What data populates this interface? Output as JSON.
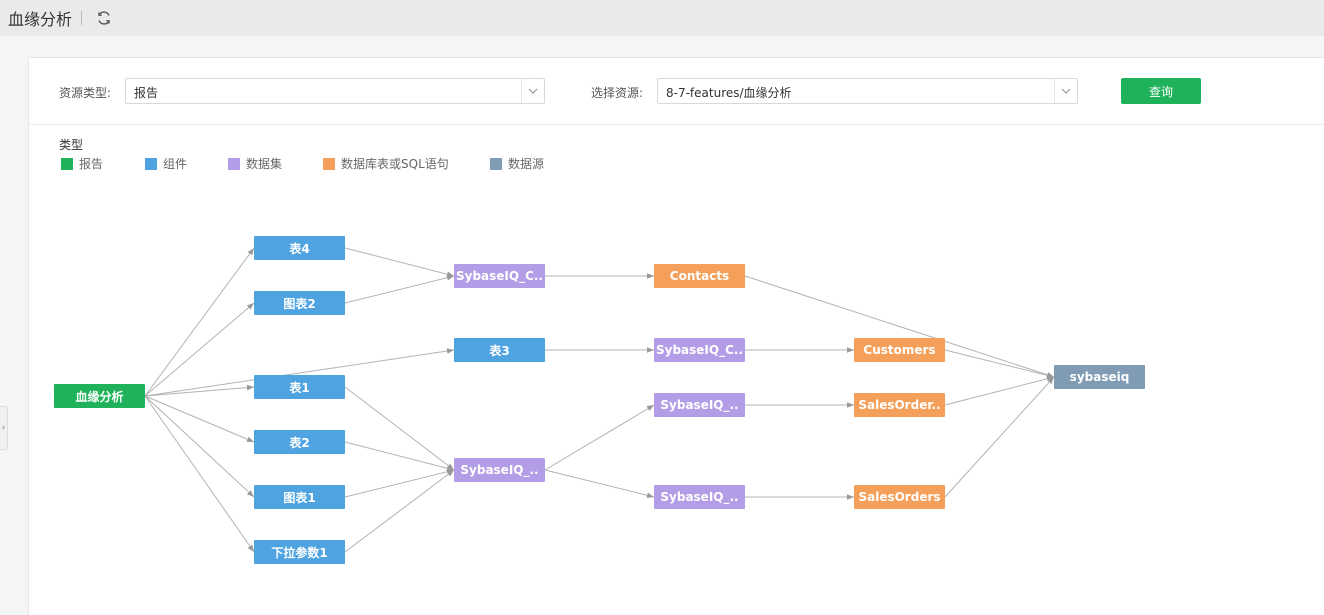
{
  "header": {
    "title": "血缘分析"
  },
  "filters": {
    "resource_type_label": "资源类型:",
    "resource_type_value": "报告",
    "resource_label": "选择资源:",
    "resource_value": "8-7-features/血缘分析",
    "query_button": "查询"
  },
  "legend": {
    "title": "类型",
    "items": [
      {
        "label": "报告",
        "color": "#1fb25a"
      },
      {
        "label": "组件",
        "color": "#4ea3e0"
      },
      {
        "label": "数据集",
        "color": "#b39de6"
      },
      {
        "label": "数据库表或SQL语句",
        "color": "#f5a05a"
      },
      {
        "label": "数据源",
        "color": "#7f9cb4"
      }
    ]
  },
  "graph": {
    "nodes": [
      {
        "id": "report",
        "label": "血缘分析",
        "type": "report"
      },
      {
        "id": "biao4",
        "label": "表4",
        "type": "component"
      },
      {
        "id": "tubiao2",
        "label": "图表2",
        "type": "component"
      },
      {
        "id": "biao1",
        "label": "表1",
        "type": "component"
      },
      {
        "id": "biao2",
        "label": "表2",
        "type": "component"
      },
      {
        "id": "tubiao1",
        "label": "图表1",
        "type": "component"
      },
      {
        "id": "xiala",
        "label": "下拉参数1",
        "type": "component"
      },
      {
        "id": "ds1",
        "label": "SybaseIQ_C..",
        "type": "dataset"
      },
      {
        "id": "biao3",
        "label": "表3",
        "type": "component"
      },
      {
        "id": "ds2",
        "label": "SybaseIQ_..",
        "type": "dataset"
      },
      {
        "id": "contacts",
        "label": "Contacts",
        "type": "table"
      },
      {
        "id": "ds3",
        "label": "SybaseIQ_C..",
        "type": "dataset"
      },
      {
        "id": "ds4",
        "label": "SybaseIQ_..",
        "type": "dataset"
      },
      {
        "id": "ds5",
        "label": "SybaseIQ_..",
        "type": "dataset"
      },
      {
        "id": "customers",
        "label": "Customers",
        "type": "table"
      },
      {
        "id": "salesorder_",
        "label": "SalesOrder..",
        "type": "table"
      },
      {
        "id": "salesorders",
        "label": "SalesOrders",
        "type": "table"
      },
      {
        "id": "sybaseiq",
        "label": "sybaseiq",
        "type": "datasource"
      }
    ],
    "edges": [
      [
        "report",
        "biao4"
      ],
      [
        "report",
        "tubiao2"
      ],
      [
        "report",
        "biao1"
      ],
      [
        "report",
        "biao2"
      ],
      [
        "report",
        "tubiao1"
      ],
      [
        "report",
        "xiala"
      ],
      [
        "report",
        "biao3"
      ],
      [
        "biao4",
        "ds1"
      ],
      [
        "tubiao2",
        "ds1"
      ],
      [
        "biao1",
        "ds2"
      ],
      [
        "biao2",
        "ds2"
      ],
      [
        "tubiao1",
        "ds2"
      ],
      [
        "xiala",
        "ds2"
      ],
      [
        "ds1",
        "contacts"
      ],
      [
        "biao3",
        "ds3"
      ],
      [
        "ds2",
        "ds4"
      ],
      [
        "ds2",
        "ds5"
      ],
      [
        "ds3",
        "customers"
      ],
      [
        "ds4",
        "salesorder_"
      ],
      [
        "ds5",
        "salesorders"
      ],
      [
        "contacts",
        "sybaseiq"
      ],
      [
        "customers",
        "sybaseiq"
      ],
      [
        "salesorder_",
        "sybaseiq"
      ],
      [
        "salesorders",
        "sybaseiq"
      ]
    ],
    "type_colors": {
      "report": "#1fb25a",
      "component": "#4ea3e0",
      "dataset": "#b39de6",
      "table": "#f5a05a",
      "datasource": "#7f9cb4"
    },
    "edge_color": "#b3b3b3",
    "arrow_color": "#999999"
  }
}
